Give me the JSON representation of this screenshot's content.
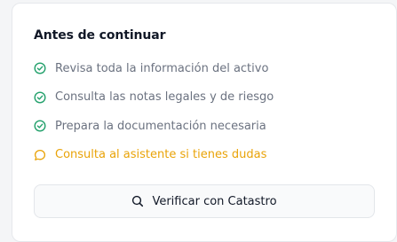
{
  "card": {
    "title": "Antes de continuar",
    "items": [
      {
        "label": "Revisa toda la información del activo",
        "icon": "check-circle-icon",
        "color": "#22a06b"
      },
      {
        "label": "Consulta las notas legales y de riesgo",
        "icon": "check-circle-icon",
        "color": "#22a06b"
      },
      {
        "label": "Prepara la documentación necesaria",
        "icon": "check-circle-icon",
        "color": "#22a06b"
      },
      {
        "label": "Consulta al asistente si tienes dudas",
        "icon": "chat-bubble-icon",
        "color": "#e9a308"
      }
    ],
    "button": {
      "label": "Verificar con Catastro",
      "icon": "search-icon"
    }
  }
}
